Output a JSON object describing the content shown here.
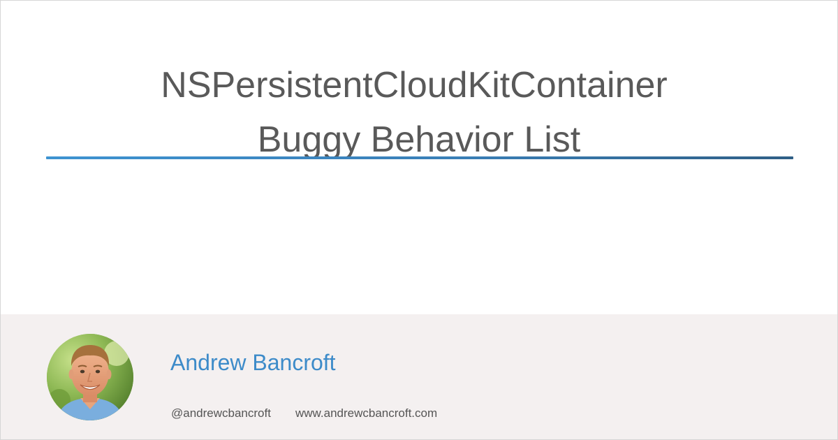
{
  "post": {
    "title_line1": "NSPersistentCloudKitContainer",
    "title_line2": "Buggy Behavior List"
  },
  "author": {
    "name": "Andrew Bancroft",
    "handle": "@andrewcbancroft",
    "website": "www.andrewcbancroft.com"
  },
  "colors": {
    "title_text": "#595959",
    "divider_start": "#3e93d1",
    "divider_end": "#2f5f86",
    "author_name": "#3d8bc9",
    "footer_background": "#f4f0f0",
    "footer_text": "#555555"
  }
}
